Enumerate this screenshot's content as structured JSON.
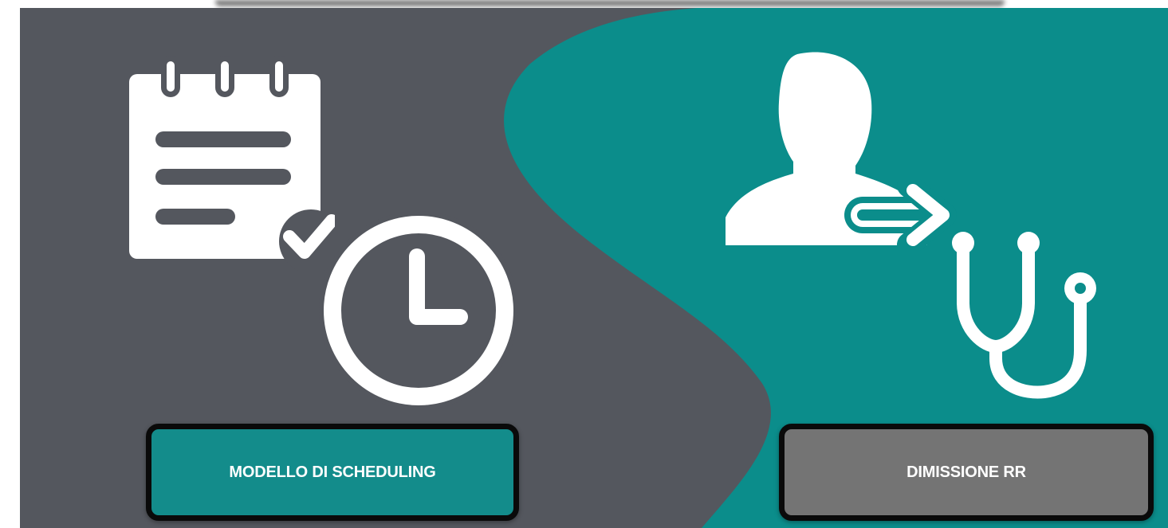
{
  "colors": {
    "dark_panel": "#54575e",
    "teal_panel": "#0b8d8b",
    "icon": "#ffffff",
    "left_button": "#138c8b",
    "right_button": "#747474",
    "button_border": "#0a0a0a"
  },
  "left": {
    "icons": [
      "notepad-check-icon",
      "clock-icon"
    ],
    "button_label": "MODELLO DI SCHEDULING"
  },
  "right": {
    "icons": [
      "patient-icon",
      "arrow-right-icon",
      "stethoscope-icon"
    ],
    "button_label": "DIMISSIONE RR"
  }
}
